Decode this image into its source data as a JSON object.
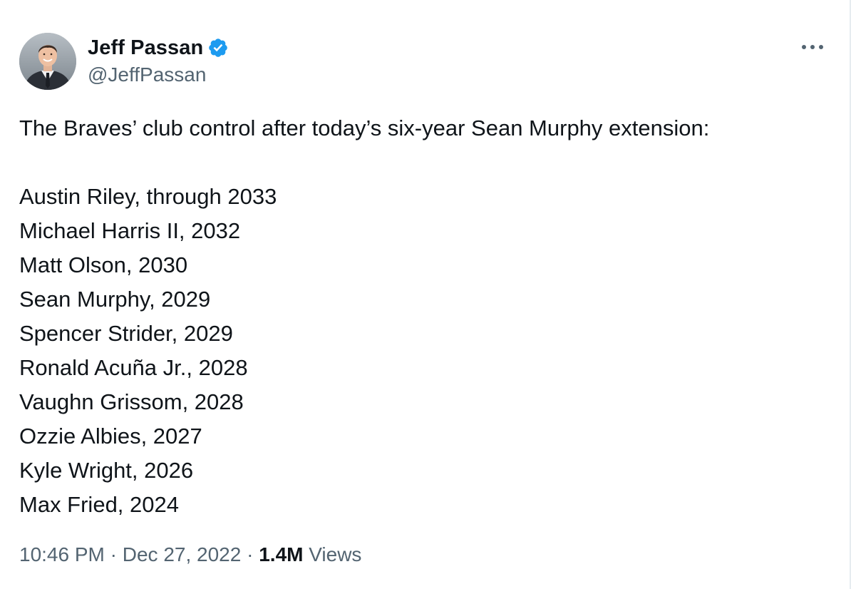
{
  "author": {
    "display_name": "Jeff Passan",
    "handle": "@JeffPassan",
    "verified": true,
    "avatar_icon": "profile-photo"
  },
  "menu": {
    "more_icon": "more-horizontal-icon"
  },
  "tweet": {
    "intro": "The Braves’ club control after today’s six-year Sean Murphy extension:",
    "lines": [
      "Austin Riley, through 2033",
      "Michael Harris II, 2032",
      "Matt Olson, 2030",
      "Sean Murphy, 2029",
      "Spencer Strider, 2029",
      "Ronald Acuña Jr., 2028",
      "Vaughn Grissom, 2028",
      "Ozzie Albies, 2027",
      "Kyle Wright, 2026",
      "Max Fried, 2024"
    ]
  },
  "meta": {
    "time": "10:46 PM",
    "separator": " · ",
    "date": "Dec 27, 2022",
    "views_count": "1.4M",
    "views_label": " Views"
  },
  "colors": {
    "text": "#0f1419",
    "secondary": "#536471",
    "verified": "#1d9bf0"
  }
}
